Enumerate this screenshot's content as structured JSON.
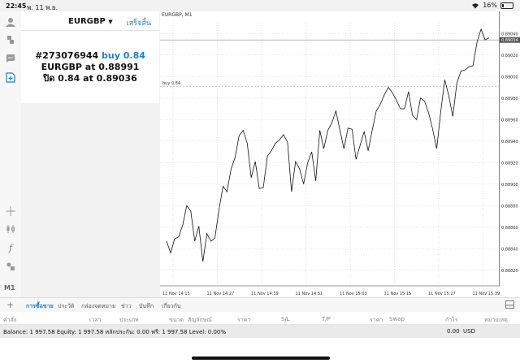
{
  "status_bar": {
    "time": "22:45",
    "date": "พ. 11 พ.ย.",
    "battery": "16%",
    "battery_level": 0.16
  },
  "toolbar": {
    "timeframe_label": "M1"
  },
  "order_panel": {
    "symbol": "EURGBP",
    "done_label": "เสร็จสิ้น",
    "ticket": "#273076944",
    "action": "buy 0.84",
    "open_line": "EURGBP at 0.88991",
    "close_prefix": "ปิด 0.84 at",
    "close_price": "0.89036"
  },
  "chart": {
    "title": "EURGBP, M1",
    "order_label": "buy 0.84"
  },
  "chart_data": {
    "type": "line",
    "series": [
      {
        "values": [
          0.88847,
          0.88836,
          0.88849,
          0.88851,
          0.88862,
          0.8888,
          0.88875,
          0.88847,
          0.88861,
          0.88828,
          0.88854,
          0.88847,
          0.8885,
          0.88876,
          0.88898,
          0.88893,
          0.88914,
          0.88925,
          0.88945,
          0.8895,
          0.88938,
          0.88906,
          0.88921,
          0.88896,
          0.88897,
          0.88926,
          0.88931,
          0.88938,
          0.88941,
          0.88946,
          0.88939,
          0.88893,
          0.88921,
          0.88914,
          0.889,
          0.8892,
          0.8893,
          0.88903,
          0.8895,
          0.88933,
          0.8895,
          0.88957,
          0.88968,
          0.8895,
          0.88933,
          0.88952,
          0.88951,
          0.88923,
          0.88936,
          0.88949,
          0.88931,
          0.8895,
          0.88968,
          0.88974,
          0.88983,
          0.8899,
          0.88985,
          0.88978,
          0.8897,
          0.8897,
          0.88986,
          0.88964,
          0.8896,
          0.8898,
          0.88977,
          0.88966,
          0.88951,
          0.88933,
          0.88967,
          0.88997,
          0.88982,
          0.88963,
          0.88994,
          0.89005,
          0.89006,
          0.89009,
          0.8901,
          0.89032,
          0.89044,
          0.89034,
          0.89036
        ]
      }
    ],
    "ylim": [
      0.8881,
      0.8905
    ],
    "y_ticks": [
      "0.89040",
      "0.89020",
      "0.89000",
      "0.88980",
      "0.88960",
      "0.88940",
      "0.88920",
      "0.88900",
      "0.88880",
      "0.88860",
      "0.88840",
      "0.88820"
    ],
    "x_ticks": [
      "11 Nov 14:15",
      "11 Nov 14:27",
      "11 Nov 14:39",
      "11 Nov 14:51",
      "11 Nov 15:03",
      "11 Nov 15:15",
      "11 Nov 15:27",
      "11 Nov 15:39"
    ],
    "current_price": "0.89034",
    "current_value": 0.89034,
    "order_value": 0.88991,
    "grid": true
  },
  "terminal": {
    "tabs": [
      "การซื้อขาย",
      "ประวัติ",
      "กล่องจดหมาย",
      "ข่าว",
      "บันทึก",
      "เกี่ยวกับ"
    ],
    "headers": [
      "คำสั่ง",
      "เวลา",
      "ประเภท",
      "ขนาด",
      "สัญลักษณ์",
      "ราคา",
      "S/L",
      "T/P",
      "ราคา",
      "Swap",
      "กำไร",
      "หมายเหตุ"
    ],
    "balance_line": "Balance: 1 997.58 Equity: 1 997.58 หลักประกัน: 0.00 ฟรี: 1 997.58 Level: 0.00%",
    "profit_total": "0.00",
    "currency": "USD"
  }
}
